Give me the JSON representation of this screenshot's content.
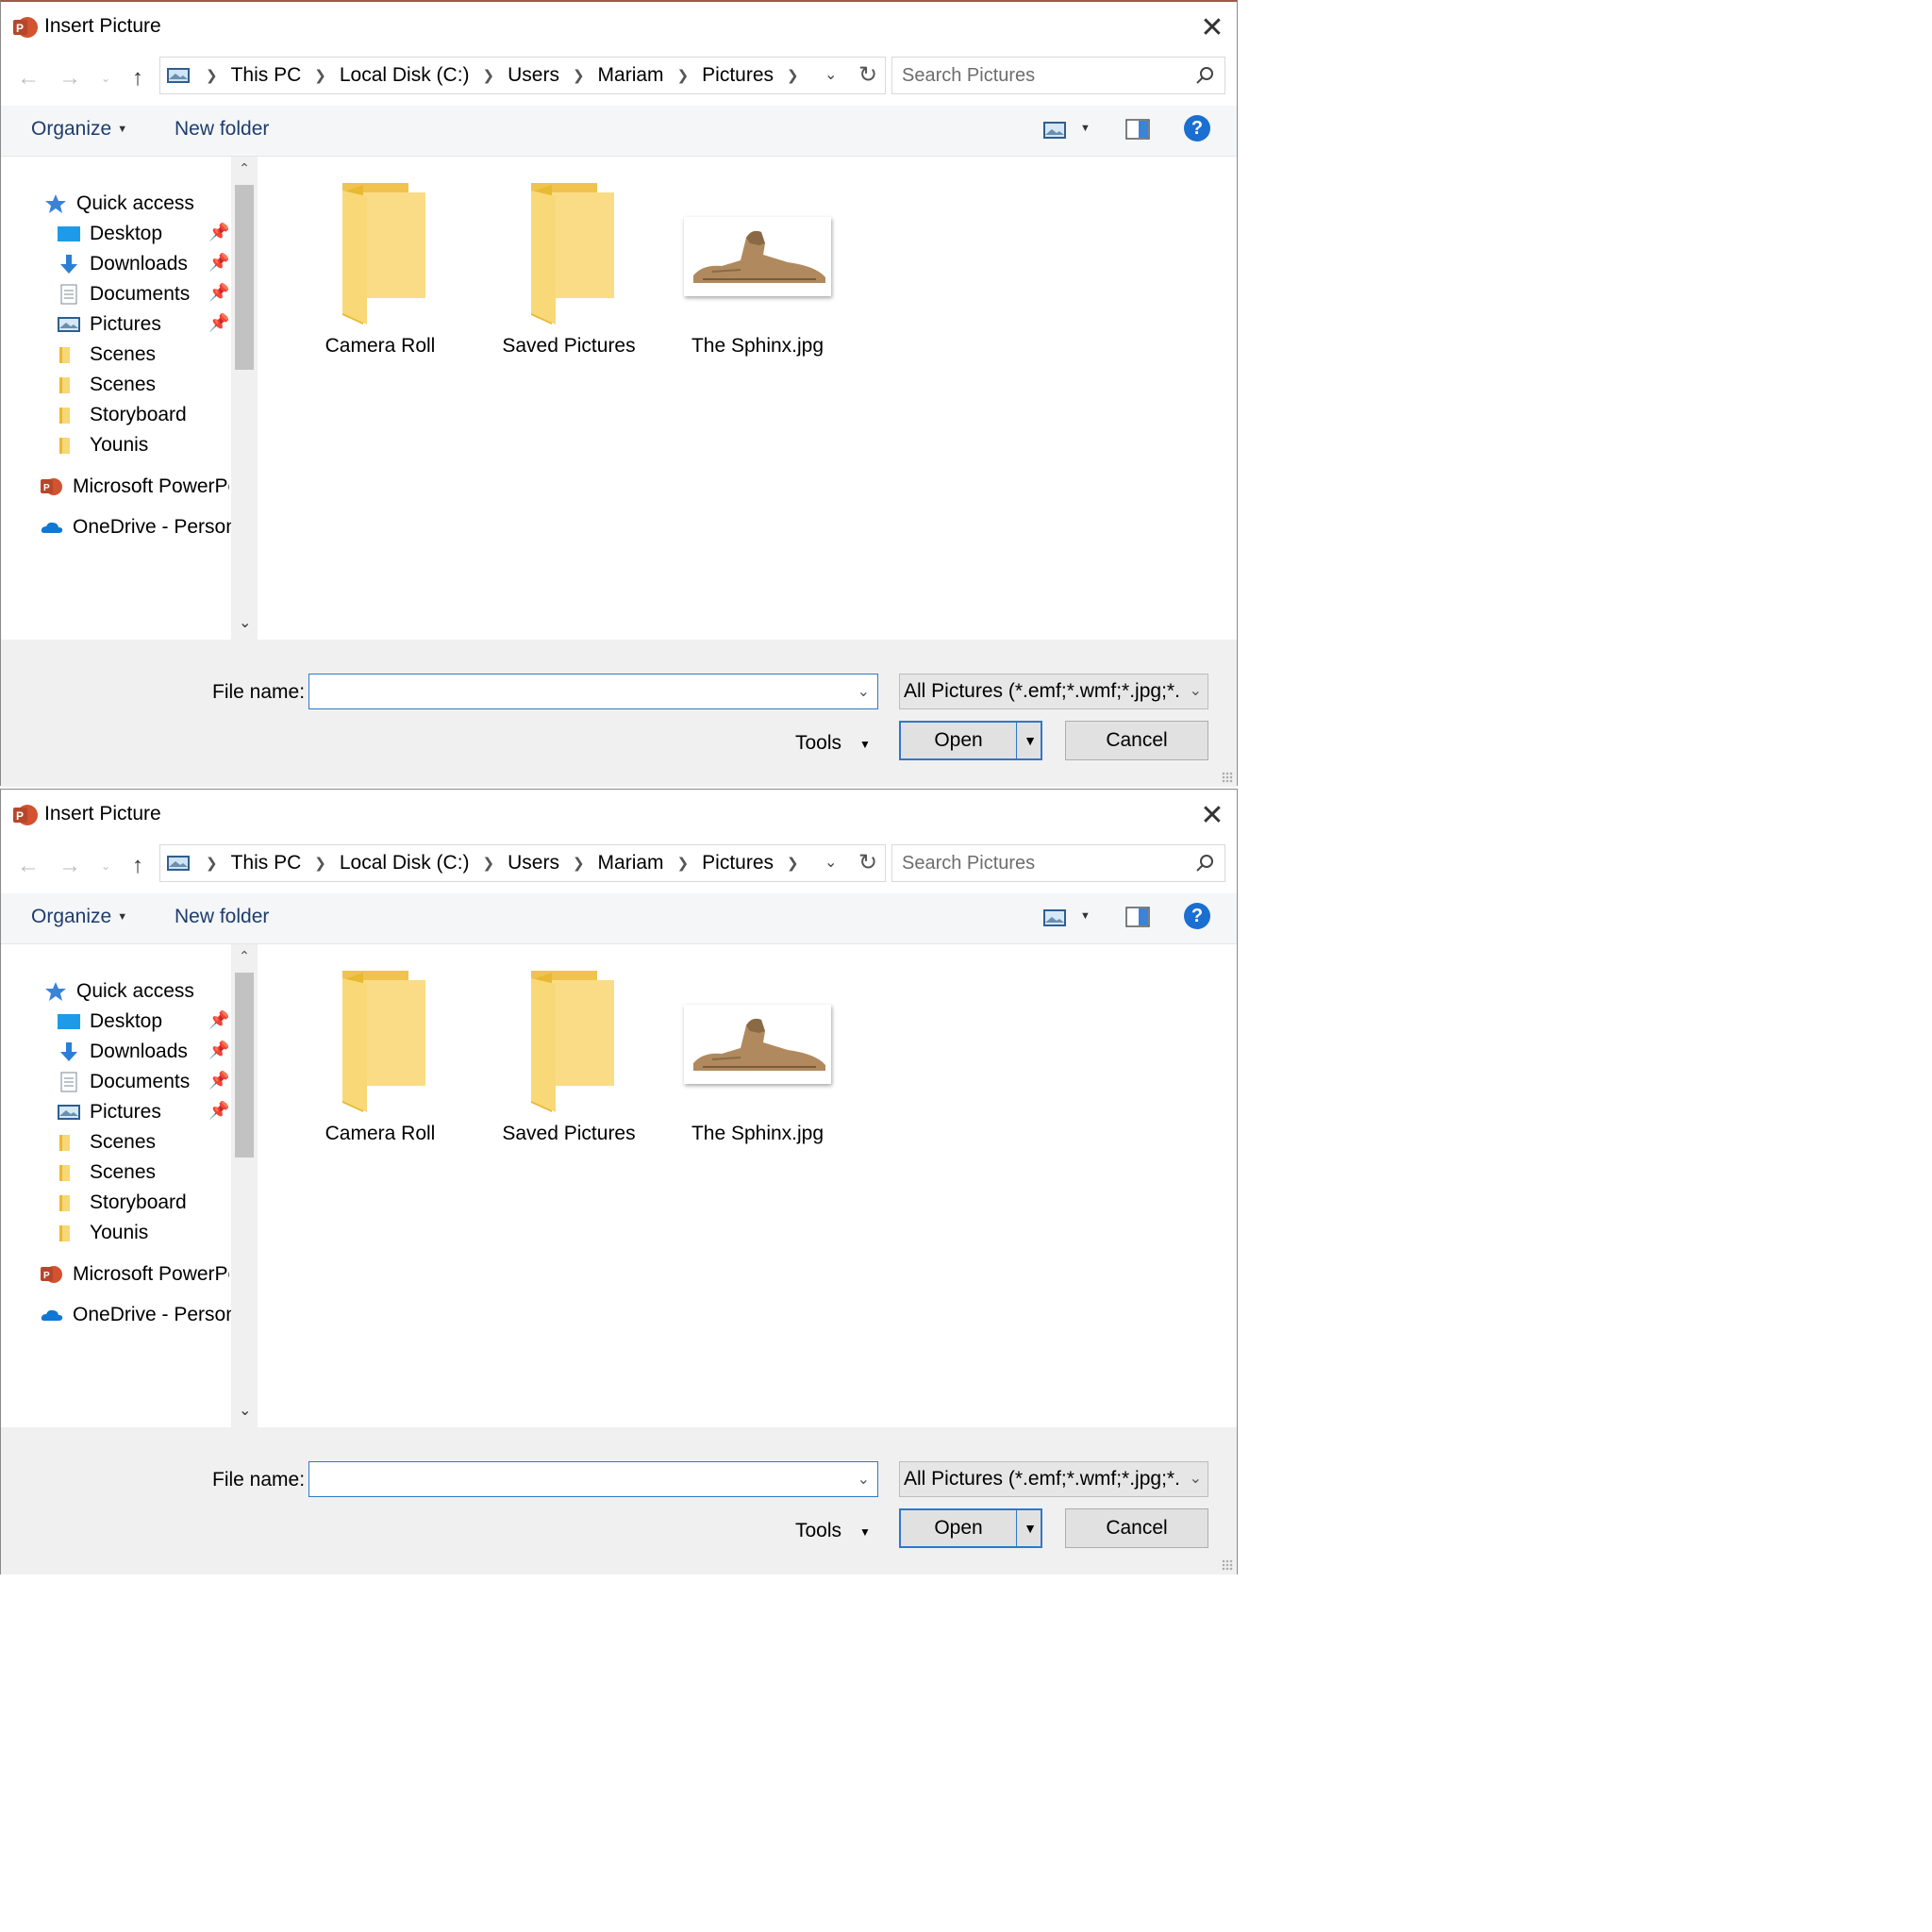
{
  "dialogs": [
    {
      "title": "Insert Picture",
      "breadcrumb": [
        "This PC",
        "Local Disk (C:)",
        "Users",
        "Mariam",
        "Pictures"
      ],
      "search_placeholder": "Search Pictures",
      "toolbar": {
        "organize": "Organize",
        "new_folder": "New folder"
      },
      "sidebar": {
        "quick_access": "Quick access",
        "items": [
          "Desktop",
          "Downloads",
          "Documents",
          "Pictures",
          "Scenes",
          "Scenes",
          "Storyboard",
          "Younis"
        ],
        "microsoft": "Microsoft PowerPc",
        "onedrive": "OneDrive - Person"
      },
      "files": [
        "Camera Roll",
        "Saved Pictures",
        "The Sphinx.jpg"
      ],
      "footer": {
        "file_name_label": "File name:",
        "file_name_value": "",
        "filter": "All Pictures (*.emf;*.wmf;*.jpg;*.",
        "tools": "Tools",
        "open": "Open",
        "cancel": "Cancel"
      }
    },
    {
      "title": "Insert Picture",
      "breadcrumb": [
        "This PC",
        "Local Disk (C:)",
        "Users",
        "Mariam",
        "Pictures"
      ],
      "search_placeholder": "Search Pictures",
      "toolbar": {
        "organize": "Organize",
        "new_folder": "New folder"
      },
      "sidebar": {
        "quick_access": "Quick access",
        "items": [
          "Desktop",
          "Downloads",
          "Documents",
          "Pictures",
          "Scenes",
          "Scenes",
          "Storyboard",
          "Younis"
        ],
        "microsoft": "Microsoft PowerPc",
        "onedrive": "OneDrive - Person"
      },
      "files": [
        "Camera Roll",
        "Saved Pictures",
        "The Sphinx.jpg"
      ],
      "footer": {
        "file_name_label": "File name:",
        "file_name_value": "",
        "filter": "All Pictures (*.emf;*.wmf;*.jpg;*.",
        "tools": "Tools",
        "open": "Open",
        "cancel": "Cancel"
      }
    }
  ],
  "colors": {
    "accent": "#2e79c9",
    "help": "#1a6fd1",
    "folder": "#f8d775"
  }
}
